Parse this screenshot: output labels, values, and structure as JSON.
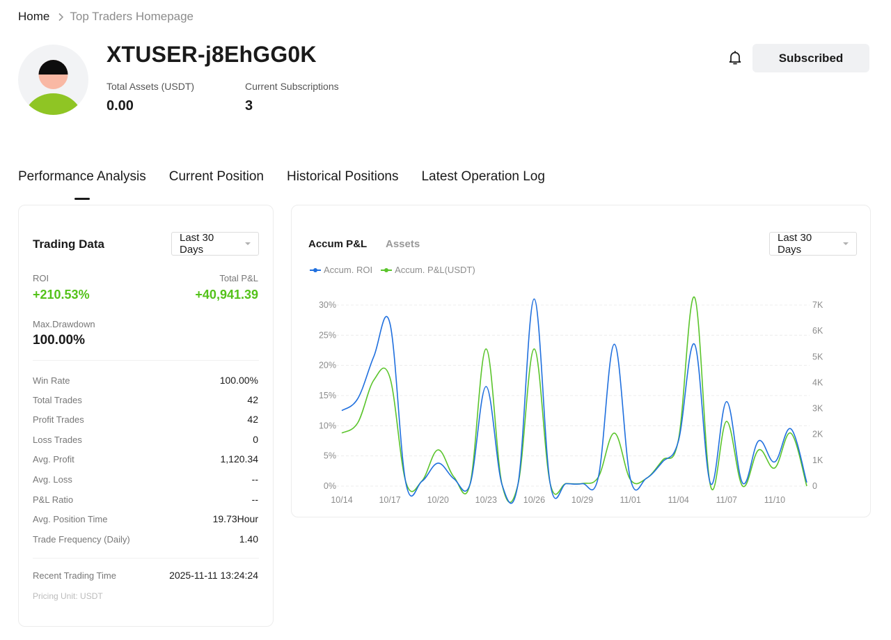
{
  "breadcrumb": {
    "home": "Home",
    "current": "Top Traders Homepage"
  },
  "profile": {
    "username": "XTUSER-j8EhGG0K",
    "total_assets_label": "Total Assets (USDT)",
    "total_assets_value": "0.00",
    "subscriptions_label": "Current Subscriptions",
    "subscriptions_value": "3",
    "subscribe_button": "Subscribed"
  },
  "tabs": [
    {
      "label": "Performance Analysis",
      "active": true
    },
    {
      "label": "Current Position",
      "active": false
    },
    {
      "label": "Historical Positions",
      "active": false
    },
    {
      "label": "Latest Operation Log",
      "active": false
    }
  ],
  "trading_data": {
    "title": "Trading Data",
    "period": "Last 30 Days",
    "roi_label": "ROI",
    "roi_value": "+210.53%",
    "pnl_label": "Total P&L",
    "pnl_value": "+40,941.39",
    "drawdown_label": "Max.Drawdown",
    "drawdown_value": "100.00%",
    "rows": [
      {
        "label": "Win Rate",
        "value": "100.00%"
      },
      {
        "label": "Total Trades",
        "value": "42"
      },
      {
        "label": "Profit Trades",
        "value": "42"
      },
      {
        "label": "Loss Trades",
        "value": "0"
      },
      {
        "label": "Avg. Profit",
        "value": "1,120.34"
      },
      {
        "label": "Avg. Loss",
        "value": "--"
      },
      {
        "label": "P&L Ratio",
        "value": "--"
      },
      {
        "label": "Avg. Position Time",
        "value": "19.73Hour"
      },
      {
        "label": "Trade Frequency (Daily)",
        "value": "1.40"
      }
    ],
    "recent_label": "Recent Trading Time",
    "recent_value": "2025-11-11 13:24:24",
    "pricing_unit": "Pricing Unit: USDT"
  },
  "chart_panel": {
    "tab_active": "Accum P&L",
    "tab_inactive": "Assets",
    "period": "Last 30 Days"
  },
  "colors": {
    "roi_line": "#1f6fde",
    "pnl_line": "#5ac42b",
    "positive": "#54c21a"
  },
  "chart_data": {
    "type": "line",
    "x": [
      "10/14",
      "10/15",
      "10/16",
      "10/17",
      "10/18",
      "10/19",
      "10/20",
      "10/21",
      "10/22",
      "10/23",
      "10/24",
      "10/25",
      "10/26",
      "10/27",
      "10/28",
      "10/29",
      "10/30",
      "10/31",
      "11/01",
      "11/02",
      "11/03",
      "11/04",
      "11/05",
      "11/06",
      "11/07",
      "11/08",
      "11/09",
      "11/10",
      "11/11"
    ],
    "x_ticks": [
      "10/14",
      "10/17",
      "10/20",
      "10/23",
      "10/26",
      "10/29",
      "11/01",
      "11/04",
      "11/07",
      "11/10"
    ],
    "series": [
      {
        "name": "Accum. ROI",
        "axis": "left",
        "values": [
          12.5,
          14.5,
          21.5,
          27.0,
          0.5,
          0.8,
          3.8,
          1.2,
          0.3,
          16.5,
          0.2,
          0.5,
          31.0,
          0.4,
          0.4,
          0.4,
          1.5,
          23.5,
          1.2,
          1.3,
          4.0,
          7.5,
          23.5,
          0.4,
          14.0,
          0.5,
          7.5,
          4.0,
          9.5,
          0.6
        ]
      },
      {
        "name": "Accum. P&L(USDT)",
        "axis": "right",
        "values": [
          2050,
          2450,
          4100,
          4200,
          150,
          200,
          1400,
          350,
          80,
          5300,
          50,
          100,
          5300,
          100,
          100,
          100,
          350,
          2050,
          250,
          300,
          1000,
          1800,
          7300,
          0,
          2500,
          0,
          1400,
          700,
          2050,
          0
        ]
      }
    ],
    "left_axis": {
      "ticks": [
        "0%",
        "5%",
        "10%",
        "15%",
        "20%",
        "25%",
        "30%"
      ],
      "ylim": [
        0,
        30
      ]
    },
    "right_axis": {
      "ticks": [
        "0",
        "1K",
        "2K",
        "3K",
        "4K",
        "5K",
        "6K",
        "7K"
      ],
      "ylim": [
        0,
        7000
      ]
    },
    "legend_position": "top-left",
    "grid": true
  }
}
